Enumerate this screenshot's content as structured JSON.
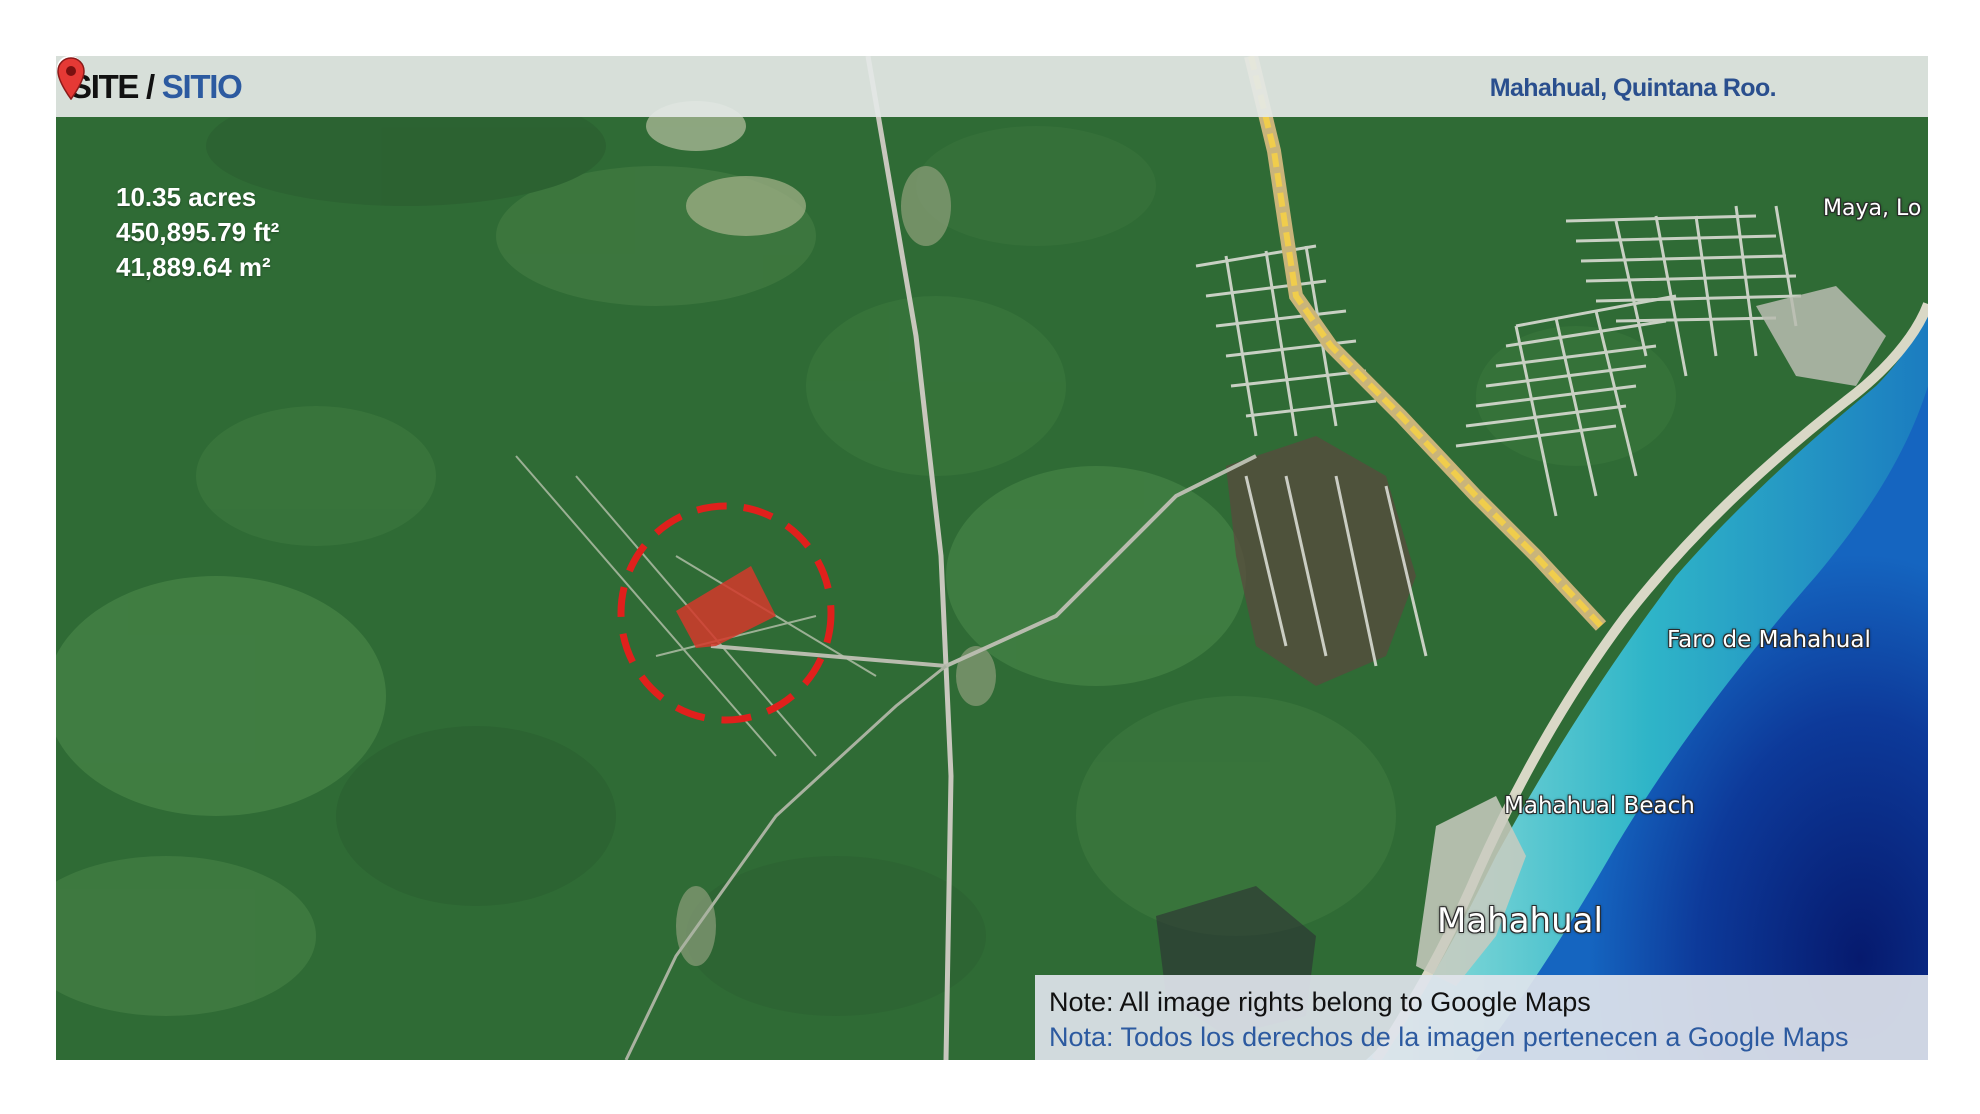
{
  "header": {
    "title_en": "SITE",
    "separator": "/",
    "title_es": "SITIO",
    "location": "Mahahual, Quintana Roo."
  },
  "site_area": {
    "acres": "10.35 acres",
    "square_feet": "450,895.79 ft²",
    "square_meters": "41,889.64 m²"
  },
  "map_places": [
    {
      "label": "Maya, Lo",
      "icon": "blue-attraction-pin-icon"
    },
    {
      "label": "Faro de Mahahual",
      "icon": "camera-pin-icon"
    },
    {
      "label": "Mahahual Beach",
      "icon": "green-beach-pin-icon"
    },
    {
      "label": "Mahahual",
      "icon": "red-location-pin-icon"
    }
  ],
  "note": {
    "en": "Note: All image rights belong to Google Maps",
    "es": "Nota: Todos los derechos de la imagen pertenecen a Google Maps"
  },
  "colors": {
    "title_accent": "#2c5aa0",
    "site_marker": "#e0201c",
    "highway": "#e8c34a",
    "sea_shallow": "#38c4d0",
    "sea_deep": "#0b2d8a",
    "forest": "#2f6b36"
  }
}
